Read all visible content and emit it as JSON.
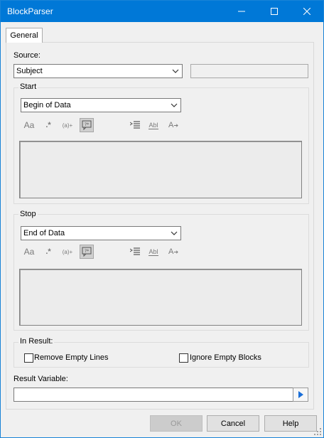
{
  "window": {
    "title": "BlockParser",
    "minimize_icon": "minimize-icon",
    "maximize_icon": "maximize-icon",
    "close_icon": "close-icon",
    "titlebar_color": "#0078d7"
  },
  "tabs": [
    {
      "label": "General",
      "selected": true
    }
  ],
  "source": {
    "label": "Source:",
    "selected": "Subject",
    "secondary_value": ""
  },
  "start": {
    "legend": "Start",
    "selected": "Begin of Data",
    "toolbar": [
      {
        "icon": "case-sensitive-icon",
        "text": "Aa"
      },
      {
        "icon": "regex-icon",
        "text": ".*"
      },
      {
        "icon": "capture-group-icon",
        "text": "(a)+"
      },
      {
        "icon": "wildcard-icon",
        "text": "?*"
      },
      {
        "icon": "multiline-icon",
        "text": ""
      },
      {
        "icon": "whole-word-icon",
        "text": "Abl"
      },
      {
        "icon": "replace-icon",
        "text": "A"
      }
    ],
    "editor_value": ""
  },
  "stop": {
    "legend": "Stop",
    "selected": "End of Data",
    "toolbar": [
      {
        "icon": "case-sensitive-icon",
        "text": "Aa"
      },
      {
        "icon": "regex-icon",
        "text": ".*"
      },
      {
        "icon": "capture-group-icon",
        "text": "(a)+"
      },
      {
        "icon": "wildcard-icon",
        "text": "?*"
      },
      {
        "icon": "multiline-icon",
        "text": ""
      },
      {
        "icon": "whole-word-icon",
        "text": "Abl"
      },
      {
        "icon": "replace-icon",
        "text": "A"
      }
    ],
    "editor_value": ""
  },
  "in_result": {
    "legend": "In Result:",
    "remove_empty_lines": {
      "label": "Remove Empty Lines",
      "checked": false
    },
    "ignore_empty_blocks": {
      "label": "Ignore Empty Blocks",
      "checked": false
    }
  },
  "result_variable": {
    "label": "Result Variable:",
    "value": "",
    "button_icon": "play-arrow-icon"
  },
  "buttons": {
    "ok": "OK",
    "cancel": "Cancel",
    "help": "Help"
  }
}
